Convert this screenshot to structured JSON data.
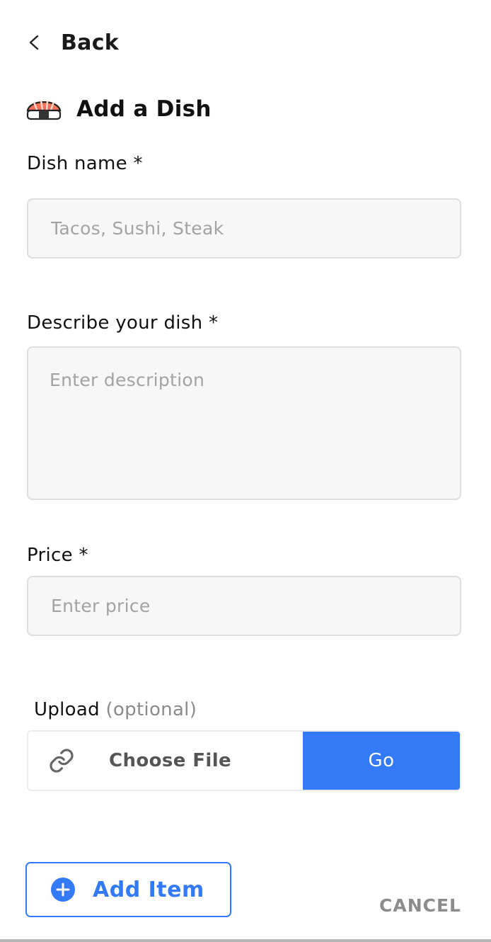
{
  "header": {
    "back_label": "Back"
  },
  "form": {
    "title": "Add a Dish",
    "dish_name": {
      "label": "Dish name *",
      "placeholder": "Tacos, Sushi, Steak",
      "value": ""
    },
    "description": {
      "label": "Describe your dish *",
      "placeholder": "Enter description",
      "value": ""
    },
    "price": {
      "label": "Price *",
      "placeholder": "Enter price",
      "value": ""
    },
    "upload": {
      "label": "Upload",
      "optional_note": "(optional)",
      "choose_label": "Choose File",
      "go_label": "Go",
      "icon": "link-icon"
    }
  },
  "actions": {
    "add_item_label": "Add Item",
    "add_item_icon": "plus-circle-icon",
    "cancel_label": "CANCEL"
  },
  "colors": {
    "accent": "#3479f6",
    "muted_text": "#8c8c8c",
    "field_bg": "#f7f7f7",
    "field_border": "#dedede"
  }
}
